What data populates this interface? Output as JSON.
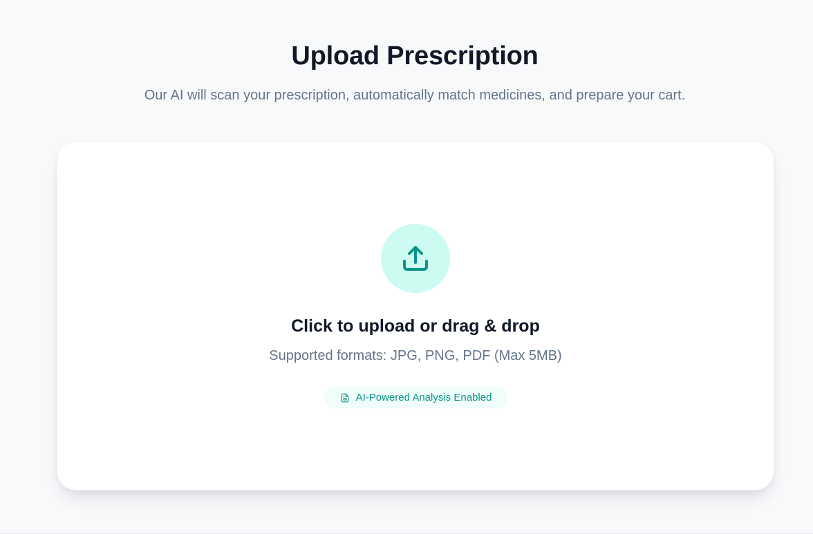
{
  "header": {
    "title": "Upload Prescription",
    "subtitle": "Our AI will scan your prescription, automatically match medicines, and prepare your cart."
  },
  "upload": {
    "icon": "upload-icon",
    "heading": "Click to upload or drag & drop",
    "formats": "Supported formats: JPG, PNG, PDF (Max 5MB)",
    "badge": {
      "icon": "document-icon",
      "label": "AI-Powered Analysis Enabled"
    }
  },
  "colors": {
    "accent": "#0d9488",
    "accent_light": "#ccfbf1",
    "badge_bg": "#f0fdfa",
    "title": "#111827",
    "muted": "#64748b",
    "background": "#f8f9fb"
  }
}
